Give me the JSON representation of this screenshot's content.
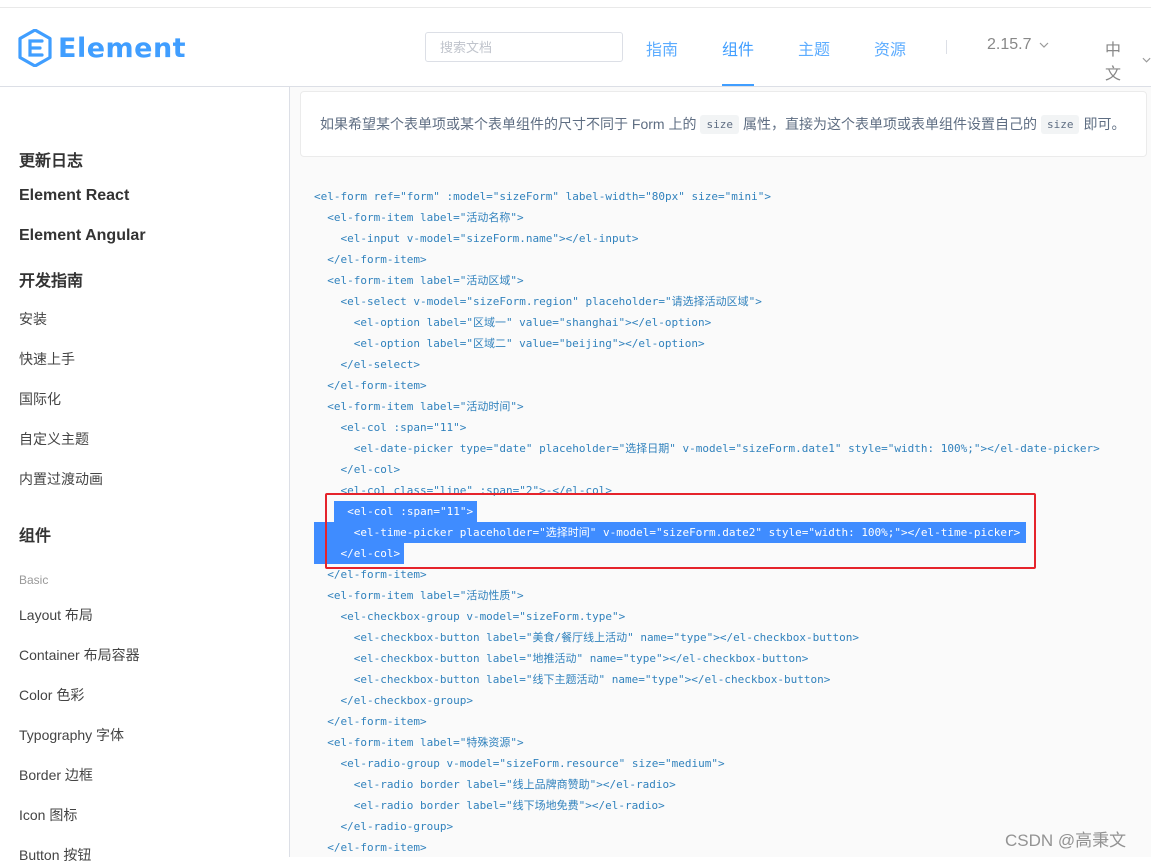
{
  "header": {
    "logo_text": "Element",
    "search_placeholder": "搜索文档",
    "nav": [
      "指南",
      "组件",
      "主题",
      "资源"
    ],
    "version": "2.15.7",
    "language": "中文",
    "accent_color": "#409eff"
  },
  "sidebar": {
    "items": [
      {
        "label": "更新日志",
        "kind": "heading"
      },
      {
        "label": "Element React",
        "kind": "heading"
      },
      {
        "label": "Element Angular",
        "kind": "heading"
      },
      {
        "label": "开发指南",
        "kind": "heading"
      },
      {
        "label": "安装",
        "kind": "link"
      },
      {
        "label": "快速上手",
        "kind": "link"
      },
      {
        "label": "国际化",
        "kind": "link"
      },
      {
        "label": "自定义主题",
        "kind": "link"
      },
      {
        "label": "内置过渡动画",
        "kind": "link"
      },
      {
        "label": "组件",
        "kind": "heading"
      },
      {
        "label": "Basic",
        "kind": "group"
      },
      {
        "label": "Layout 布局",
        "kind": "link"
      },
      {
        "label": "Container 布局容器",
        "kind": "link"
      },
      {
        "label": "Color 色彩",
        "kind": "link"
      },
      {
        "label": "Typography 字体",
        "kind": "link"
      },
      {
        "label": "Border 边框",
        "kind": "link"
      },
      {
        "label": "Icon 图标",
        "kind": "link"
      },
      {
        "label": "Button 按钮",
        "kind": "link"
      }
    ]
  },
  "tip": {
    "text1": "如果希望某个表单项或某个表单组件的尺寸不同于 Form 上的",
    "code1": "size",
    "text2": "属性，直接为这个表单项或表单组件设置自己的",
    "code2": "size",
    "text3": "即可。"
  },
  "code_lines": [
    "<el-form ref=\"form\" :model=\"sizeForm\" label-width=\"80px\" size=\"mini\">",
    "  <el-form-item label=\"活动名称\">",
    "    <el-input v-model=\"sizeForm.name\"></el-input>",
    "  </el-form-item>",
    "  <el-form-item label=\"活动区域\">",
    "    <el-select v-model=\"sizeForm.region\" placeholder=\"请选择活动区域\">",
    "      <el-option label=\"区域一\" value=\"shanghai\"></el-option>",
    "      <el-option label=\"区域二\" value=\"beijing\"></el-option>",
    "    </el-select>",
    "  </el-form-item>",
    "  <el-form-item label=\"活动时间\">",
    "    <el-col :span=\"11\">",
    "      <el-date-picker type=\"date\" placeholder=\"选择日期\" v-model=\"sizeForm.date1\" style=\"width: 100%;\"></el-date-picker>",
    "    </el-col>",
    "    <el-col class=\"line\" :span=\"2\">-</el-col>",
    "    <el-col :span=\"11\">",
    "      <el-time-picker placeholder=\"选择时间\" v-model=\"sizeForm.date2\" style=\"width: 100%;\"></el-time-picker>",
    "    </el-col>",
    "  </el-form-item>",
    "  <el-form-item label=\"活动性质\">",
    "    <el-checkbox-group v-model=\"sizeForm.type\">",
    "      <el-checkbox-button label=\"美食/餐厅线上活动\" name=\"type\"></el-checkbox-button>",
    "      <el-checkbox-button label=\"地推活动\" name=\"type\"></el-checkbox-button>",
    "      <el-checkbox-button label=\"线下主题活动\" name=\"type\"></el-checkbox-button>",
    "    </el-checkbox-group>",
    "  </el-form-item>",
    "  <el-form-item label=\"特殊资源\">",
    "    <el-radio-group v-model=\"sizeForm.resource\" size=\"medium\">",
    "      <el-radio border label=\"线上品牌商赞助\"></el-radio>",
    "      <el-radio border label=\"线下场地免费\"></el-radio>",
    "    </el-radio-group>",
    "  </el-form-item>"
  ],
  "selected_lines": [
    15,
    16,
    17
  ],
  "watermark": "CSDN @高秉文"
}
